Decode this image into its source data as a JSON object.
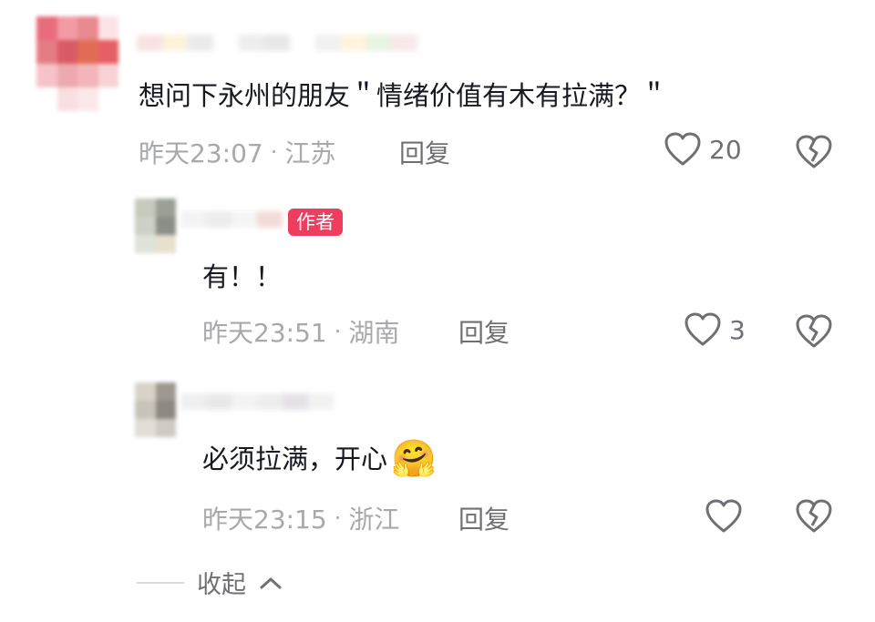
{
  "comments": [
    {
      "text": "想问下永州的朋友＂情绪价值有木有拉满？＂",
      "time": "昨天23:07",
      "location": "江苏",
      "reply_label": "回复",
      "likes": "20"
    }
  ],
  "replies": [
    {
      "badge": "作者",
      "text": "有！！",
      "time": "昨天23:51",
      "location": "湖南",
      "reply_label": "回复",
      "likes": "3"
    },
    {
      "text": "必须拉满，开心",
      "emoji": "🤗",
      "time": "昨天23:15",
      "location": "浙江",
      "reply_label": "回复",
      "likes": ""
    }
  ],
  "collapse_label": "收起",
  "colors": {
    "badge": "#ee3e5f",
    "meta": "#a8a9ad",
    "icon": "#6f7076"
  },
  "icons": [
    "heart-icon",
    "broken-heart-icon",
    "chevron-up-icon"
  ]
}
